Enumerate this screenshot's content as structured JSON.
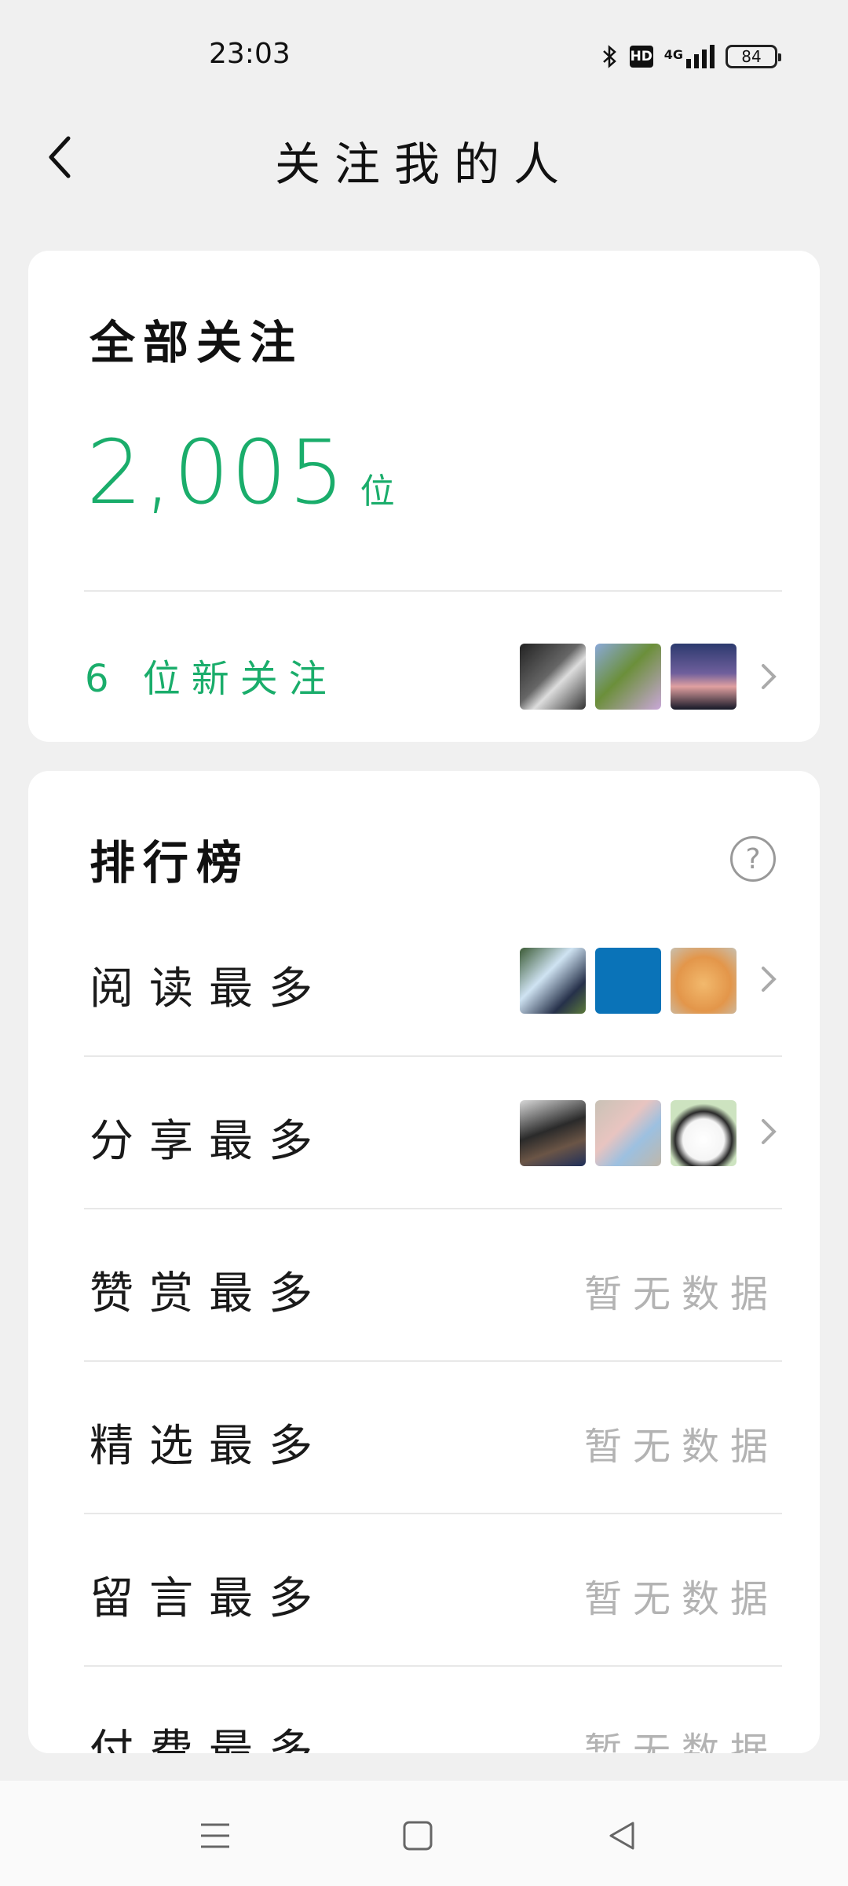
{
  "status_bar": {
    "time": "23:03",
    "battery": "84",
    "network": "4G"
  },
  "header": {
    "title": "关注我的人"
  },
  "follow_card": {
    "title": "全部关注",
    "count": "2,005",
    "unit": "位",
    "new_followers": "6 位新关注"
  },
  "rank_card": {
    "title": "排行榜",
    "rows": [
      {
        "label": "阅读最多",
        "value": ""
      },
      {
        "label": "分享最多",
        "value": ""
      },
      {
        "label": "赞赏最多",
        "value": "暂无数据"
      },
      {
        "label": "精选最多",
        "value": "暂无数据"
      },
      {
        "label": "留言最多",
        "value": "暂无数据"
      },
      {
        "label": "付费最多",
        "value": "暂无数据"
      }
    ]
  },
  "colors": {
    "accent": "#1aad6b",
    "background": "#f0f0f0",
    "muted": "#b3b3b3"
  },
  "icons": [
    "bluetooth-icon",
    "hd-icon",
    "signal-icon",
    "battery-icon",
    "back-icon",
    "help-icon",
    "chevron-right-icon",
    "menu-icon",
    "home-icon",
    "back-triangle-icon"
  ]
}
